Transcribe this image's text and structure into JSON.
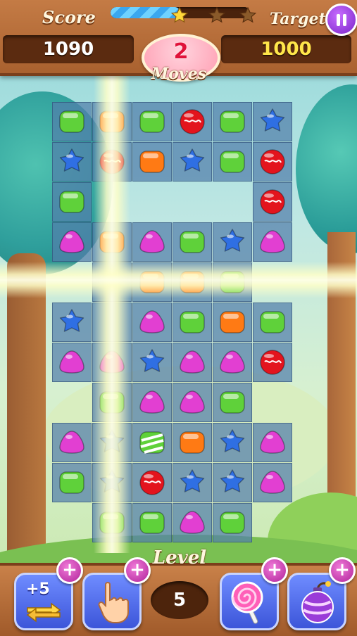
{
  "hud": {
    "score_label": "Score",
    "score_value": "1090",
    "target_label": "Target",
    "target_value": "1000",
    "moves_value": "2",
    "moves_label": "Moves",
    "progress_fraction": 0.5,
    "stars_earned": 1,
    "stars_total": 3
  },
  "board": {
    "rows": [
      [
        "green",
        "orange",
        "green",
        "red",
        "green",
        "blue"
      ],
      [
        "blue",
        "red",
        "orange",
        "blue",
        "green",
        "red"
      ],
      [
        "green",
        null,
        null,
        null,
        null,
        "red"
      ],
      [
        "pink",
        "orange",
        "pink",
        "green",
        "blue",
        "pink"
      ],
      [
        null,
        null,
        "orange",
        "orange",
        "green",
        null
      ],
      [
        "blue",
        null,
        "pink",
        "green",
        "orange",
        "green"
      ],
      [
        "pink",
        "pink",
        "blue",
        "pink",
        "pink",
        "red"
      ],
      [
        null,
        "green",
        "pink",
        "pink",
        "green",
        null
      ],
      [
        "pink",
        "blue",
        "striped",
        "orange",
        "blue",
        "pink"
      ],
      [
        "green",
        "blue",
        "red",
        "blue",
        "blue",
        "pink"
      ],
      [
        null,
        "green",
        "green",
        "pink",
        "green",
        null
      ]
    ],
    "cells": [
      [
        1,
        1,
        1,
        1,
        1,
        1
      ],
      [
        1,
        1,
        1,
        1,
        1,
        1
      ],
      [
        1,
        0,
        0,
        0,
        0,
        1
      ],
      [
        1,
        1,
        1,
        1,
        1,
        1
      ],
      [
        0,
        1,
        1,
        1,
        1,
        0
      ],
      [
        1,
        1,
        1,
        1,
        1,
        1
      ],
      [
        1,
        1,
        1,
        1,
        1,
        1
      ],
      [
        0,
        1,
        1,
        1,
        1,
        0
      ],
      [
        1,
        1,
        1,
        1,
        1,
        1
      ],
      [
        1,
        1,
        1,
        1,
        1,
        1
      ],
      [
        0,
        1,
        1,
        1,
        1,
        0
      ]
    ]
  },
  "bottom": {
    "level_label": "Level",
    "level_value": "5",
    "plus5_text": "+5",
    "plus_symbol": "+",
    "boosters": [
      "swap-plus5-booster",
      "hand-booster",
      "lollipop-booster",
      "bomb-booster"
    ]
  },
  "colors": {
    "green": "#5fd13a",
    "orange": "#ff7a14",
    "red": "#e3141d",
    "blue": "#2f6fe3",
    "pink": "#e23fd2"
  }
}
